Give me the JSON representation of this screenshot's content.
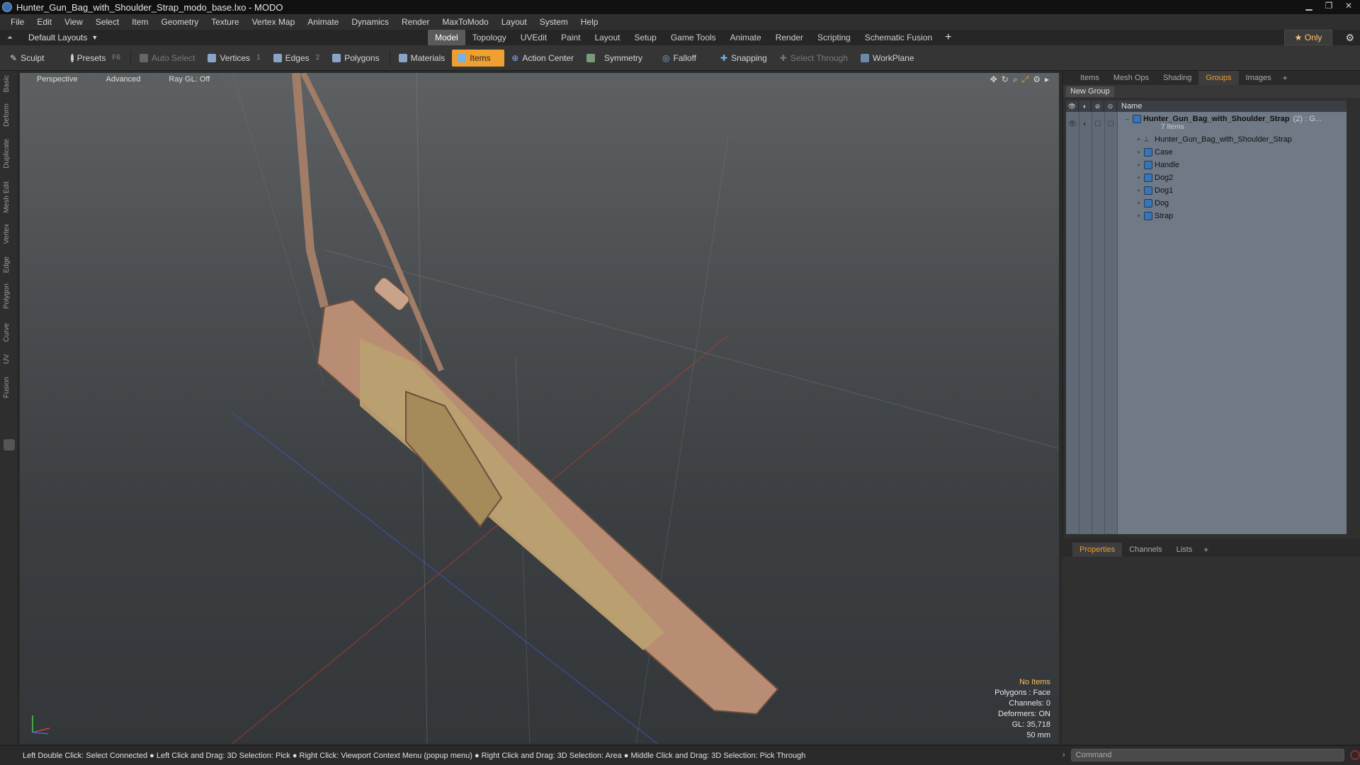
{
  "window": {
    "title": "Hunter_Gun_Bag_with_Shoulder_Strap_modo_base.lxo - MODO"
  },
  "menu": [
    "File",
    "Edit",
    "View",
    "Select",
    "Item",
    "Geometry",
    "Texture",
    "Vertex Map",
    "Animate",
    "Dynamics",
    "Render",
    "MaxToModo",
    "Layout",
    "System",
    "Help"
  ],
  "layoutbar": {
    "layout_select": "Default Layouts",
    "tabs": [
      "Model",
      "Topology",
      "UVEdit",
      "Paint",
      "Layout",
      "Setup",
      "Game Tools",
      "Animate",
      "Render",
      "Scripting",
      "Schematic Fusion"
    ],
    "active_tab": "Model",
    "plus": "+",
    "only_label": "Only"
  },
  "toolbar": {
    "sculpt": "Sculpt",
    "presets": "Presets",
    "presets_key": "F6",
    "auto_select": "Auto Select",
    "vertices": "Vertices",
    "vertices_key": "1",
    "edges": "Edges",
    "edges_key": "2",
    "polygons": "Polygons",
    "materials": "Materials",
    "items": "Items",
    "action_center": "Action Center",
    "symmetry": "Symmetry",
    "falloff": "Falloff",
    "snapping": "Snapping",
    "select_through": "Select Through",
    "workplane": "WorkPlane"
  },
  "left_tabs": [
    "Basic",
    "Deform",
    "Duplicate",
    "Mesh Edit",
    "Vertex",
    "Edge",
    "Polygon",
    "Curve",
    "UV",
    "Fusion"
  ],
  "viewport": {
    "view": "Perspective",
    "shading": "Advanced",
    "raygl": "Ray GL: Off",
    "info": {
      "selection": "No Items",
      "polygons": "Polygons : Face",
      "channels": "Channels: 0",
      "deformers": "Deformers: ON",
      "gl": "GL: 35,718",
      "scale": "50 mm"
    }
  },
  "rightpanel": {
    "tabs": [
      "Items",
      "Mesh Ops",
      "Shading",
      "Groups",
      "Images"
    ],
    "active_tab": "Groups",
    "new_group": "New Group",
    "name_header": "Name",
    "group": {
      "name": "Hunter_Gun_Bag_with_Shoulder_Strap",
      "suffix": "(2) : G...",
      "count": "7 Items"
    },
    "items": [
      "Hunter_Gun_Bag_with_Shoulder_Strap",
      "Case",
      "Handle",
      "Dog2",
      "Dog1",
      "Dog",
      "Strap"
    ]
  },
  "props": {
    "tabs": [
      "Properties",
      "Channels",
      "Lists"
    ],
    "active_tab": "Properties"
  },
  "status": {
    "text": "Left Double Click: Select Connected ● Left Click and Drag: 3D Selection: Pick ● Right Click: Viewport Context Menu (popup menu) ● Right Click and Drag: 3D Selection: Area ● Middle Click and Drag: 3D Selection: Pick Through",
    "command_placeholder": "Command"
  },
  "colors": {
    "accent": "#f0a030",
    "viewport_top": "#5d6163",
    "viewport_bottom": "#33373a",
    "group_panel": "#6f7a86"
  }
}
